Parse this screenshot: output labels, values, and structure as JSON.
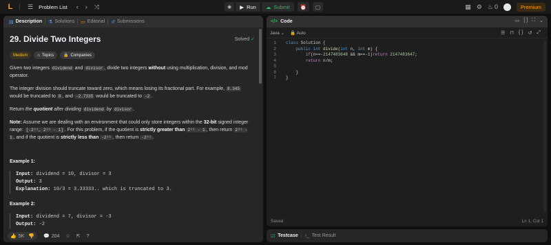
{
  "topbar": {
    "logo": "L",
    "problem_list_label": "Problem List",
    "run_label": "Run",
    "submit_label": "Submit",
    "streak_count": "0",
    "premium_label": "Premium"
  },
  "left_tabs": [
    "Description",
    "Solutions",
    "Editorial",
    "Submissions"
  ],
  "problem": {
    "title": "29. Divide Two Integers",
    "solved_label": "Solved",
    "difficulty": "Medium",
    "topics_label": "Topics",
    "companies_label": "Companies",
    "p1": {
      "a": "Given two integers ",
      "code1": "dividend",
      "b": " and ",
      "code2": "divisor",
      "c": ", divide two integers ",
      "bold": "without",
      "d": " using multiplication, division, and mod operator."
    },
    "p2": {
      "a": "The integer division should truncate toward zero, which means losing its fractional part. For example, ",
      "code1": "8.345",
      "b": " would be truncated to ",
      "code2": "8",
      "c": ", and ",
      "code3": "-2.7335",
      "d": " would be truncated to ",
      "code4": "-2",
      "e": "."
    },
    "p3": {
      "a": "Return ",
      "em1": "the ",
      "bem": "quotient",
      "em2": " after dividing ",
      "code1": "dividend",
      "em3": " by ",
      "code2": "divisor",
      "e": "."
    },
    "p4": {
      "note": "Note:",
      "a": " Assume we are dealing with an environment that could only store integers within the ",
      "bits": "32-bit",
      "b": " signed integer range: ",
      "range": "[-2³¹, 2³¹ - 1]",
      "c": ". For this problem, if the quotient is ",
      "sg": "strictly greater than",
      "code1": "2³¹ - 1",
      "d": ", then return ",
      "code2": "2³¹ - 1",
      "e": ", and if the quotient is ",
      "sl": "strictly less than",
      "code3": "-2³¹",
      "f": ", then return ",
      "code4": "-2³¹",
      "g": "."
    },
    "examples": [
      {
        "title": "Example 1:",
        "input_label": "Input:",
        "input": " dividend = 10, divisor = 3",
        "output_label": "Output:",
        "output": " 3",
        "expl_label": "Explanation:",
        "expl": " 10/3 = 3.33333.. which is truncated to 3."
      },
      {
        "title": "Example 2:",
        "input_label": "Input:",
        "input": " dividend = 7, divisor = -3",
        "output_label": "Output:",
        "output": " -2"
      }
    ]
  },
  "left_footer": {
    "likes": "5K",
    "comments": "204"
  },
  "code_panel": {
    "title": "Code",
    "language": "Java",
    "autocomplete": "Auto",
    "saved": "Saved",
    "cursor": "Ln 1, Col 1",
    "lines": [
      {
        "n": "1",
        "segs": [
          [
            "kw",
            "class "
          ],
          [
            "tx",
            "Solution {"
          ]
        ]
      },
      {
        "n": "2",
        "segs": [
          [
            "tx",
            "    "
          ],
          [
            "kw",
            "public int "
          ],
          [
            "fn",
            "divide"
          ],
          [
            "tx",
            "("
          ],
          [
            "kw",
            "int "
          ],
          [
            "tx",
            "n, "
          ],
          [
            "kw",
            "int "
          ],
          [
            "tx",
            "m) {"
          ]
        ]
      },
      {
        "n": "3",
        "segs": [
          [
            "tx",
            "        "
          ],
          [
            "kwc",
            "if"
          ],
          [
            "tx",
            "(n=="
          ],
          [
            "num",
            "-2147483648"
          ],
          [
            "tx",
            " && m=="
          ],
          [
            "num",
            "-1"
          ],
          [
            "tx",
            ")"
          ],
          [
            "kwc",
            "return "
          ],
          [
            "num",
            "2147483647"
          ],
          [
            "tx",
            ";"
          ]
        ]
      },
      {
        "n": "4",
        "segs": [
          [
            "tx",
            "        "
          ],
          [
            "kwc",
            "return "
          ],
          [
            "tx",
            "n/m;"
          ]
        ]
      },
      {
        "n": "5",
        "segs": [
          [
            "tx",
            ""
          ]
        ]
      },
      {
        "n": "6",
        "segs": [
          [
            "tx",
            "    }"
          ]
        ]
      },
      {
        "n": "7",
        "segs": [
          [
            "tx",
            "}"
          ]
        ]
      }
    ]
  },
  "test_panel": {
    "testcase_label": "Testcase",
    "result_label": "Test Result"
  }
}
